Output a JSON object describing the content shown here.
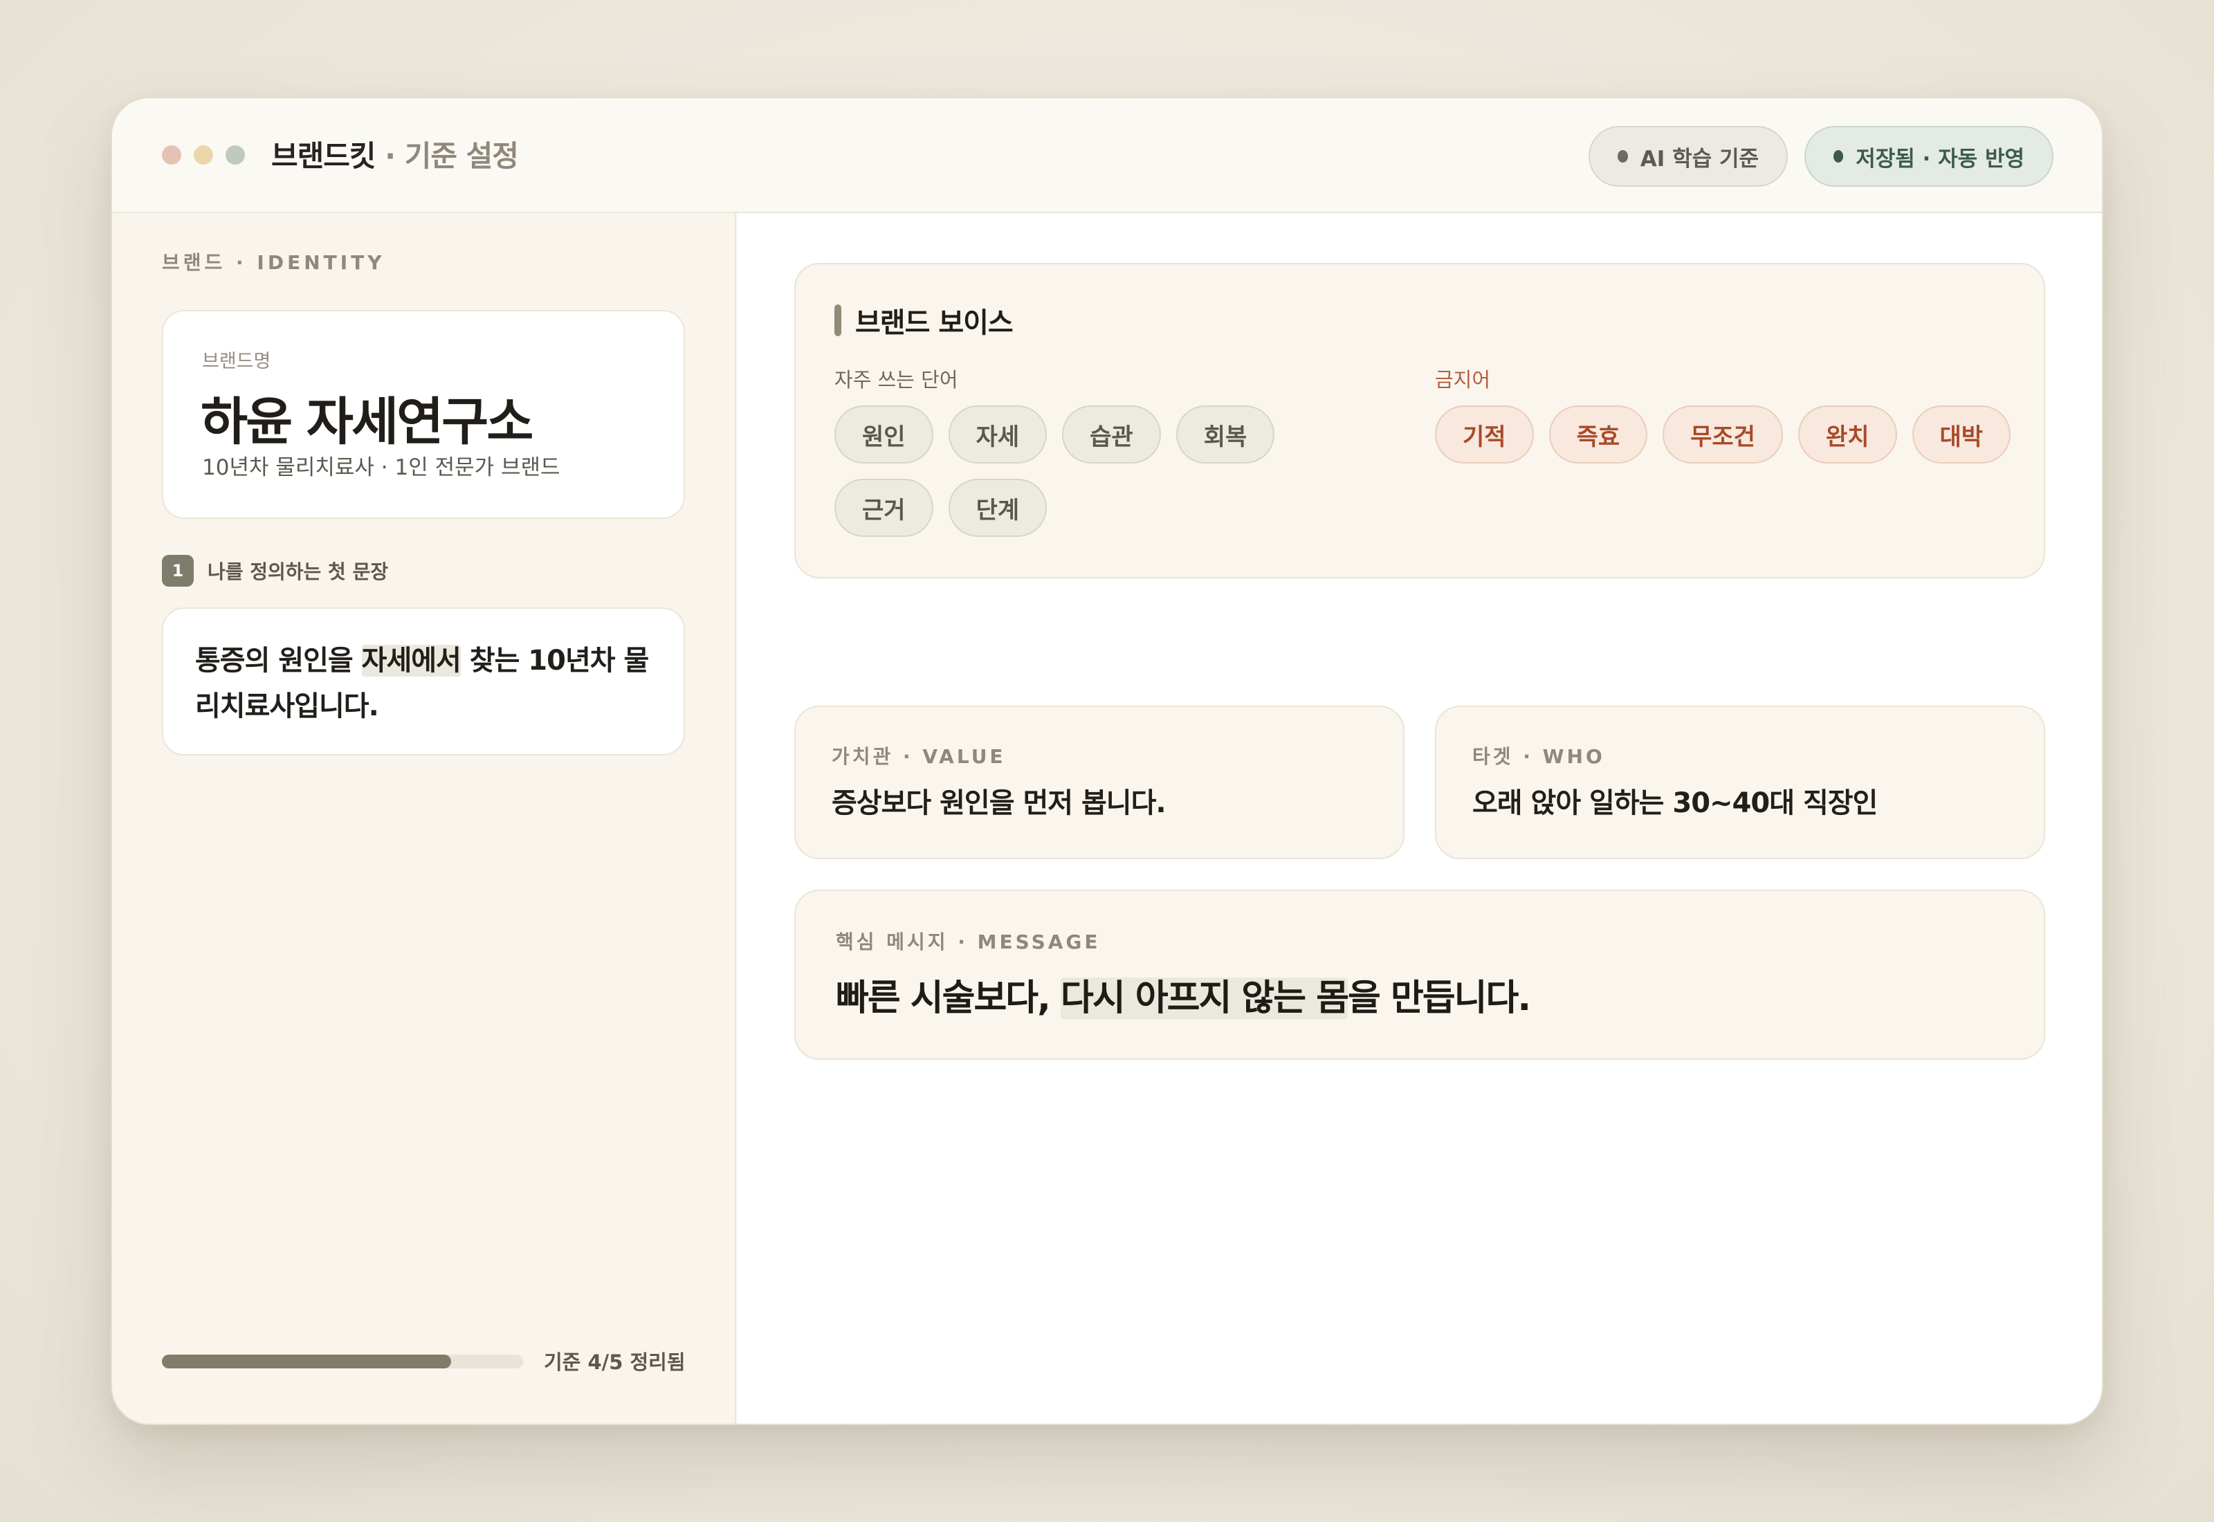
{
  "window": {
    "app_name": "브랜드킷",
    "app_subtitle": " · 기준 설정",
    "pills": {
      "ai_label": "AI 학습 기준",
      "saved_label": "저장됨 · 자동 반영"
    }
  },
  "sidebar": {
    "section_label": "브랜드 · IDENTITY",
    "brand": {
      "label": "브랜드명",
      "name": "하윤 자세연구소",
      "description": "10년차 물리치료사 · 1인 전문가 브랜드"
    },
    "step": {
      "number": "1",
      "label": "나를 정의하는 첫 문장"
    },
    "sentence": {
      "before": "통증의 원인을 ",
      "highlight": "자세에서",
      "after": " 찾는 10년차 물리치료사입니다."
    },
    "progress": {
      "text": "기준 4/5 정리됨",
      "completed": 4,
      "total": 5
    }
  },
  "main": {
    "voice": {
      "title": "브랜드 보이스",
      "frequent_label": "자주 쓰는 단어",
      "frequent_words": [
        "원인",
        "자세",
        "습관",
        "회복",
        "근거",
        "단계"
      ],
      "banned_label": "금지어",
      "banned_words": [
        "기적",
        "즉효",
        "무조건",
        "완치",
        "대박"
      ]
    },
    "value": {
      "label": "가치관 · VALUE",
      "text": "증상보다 원인을 먼저 봅니다."
    },
    "who": {
      "label": "타겟 · WHO",
      "text": "오래 앉아 일하는 30~40대 직장인"
    },
    "message": {
      "label": "핵심 메시지 · MESSAGE",
      "before": "빠른 시술보다, ",
      "highlight": "다시 아프지 않는 몸",
      "after": "을 만듭니다."
    }
  }
}
